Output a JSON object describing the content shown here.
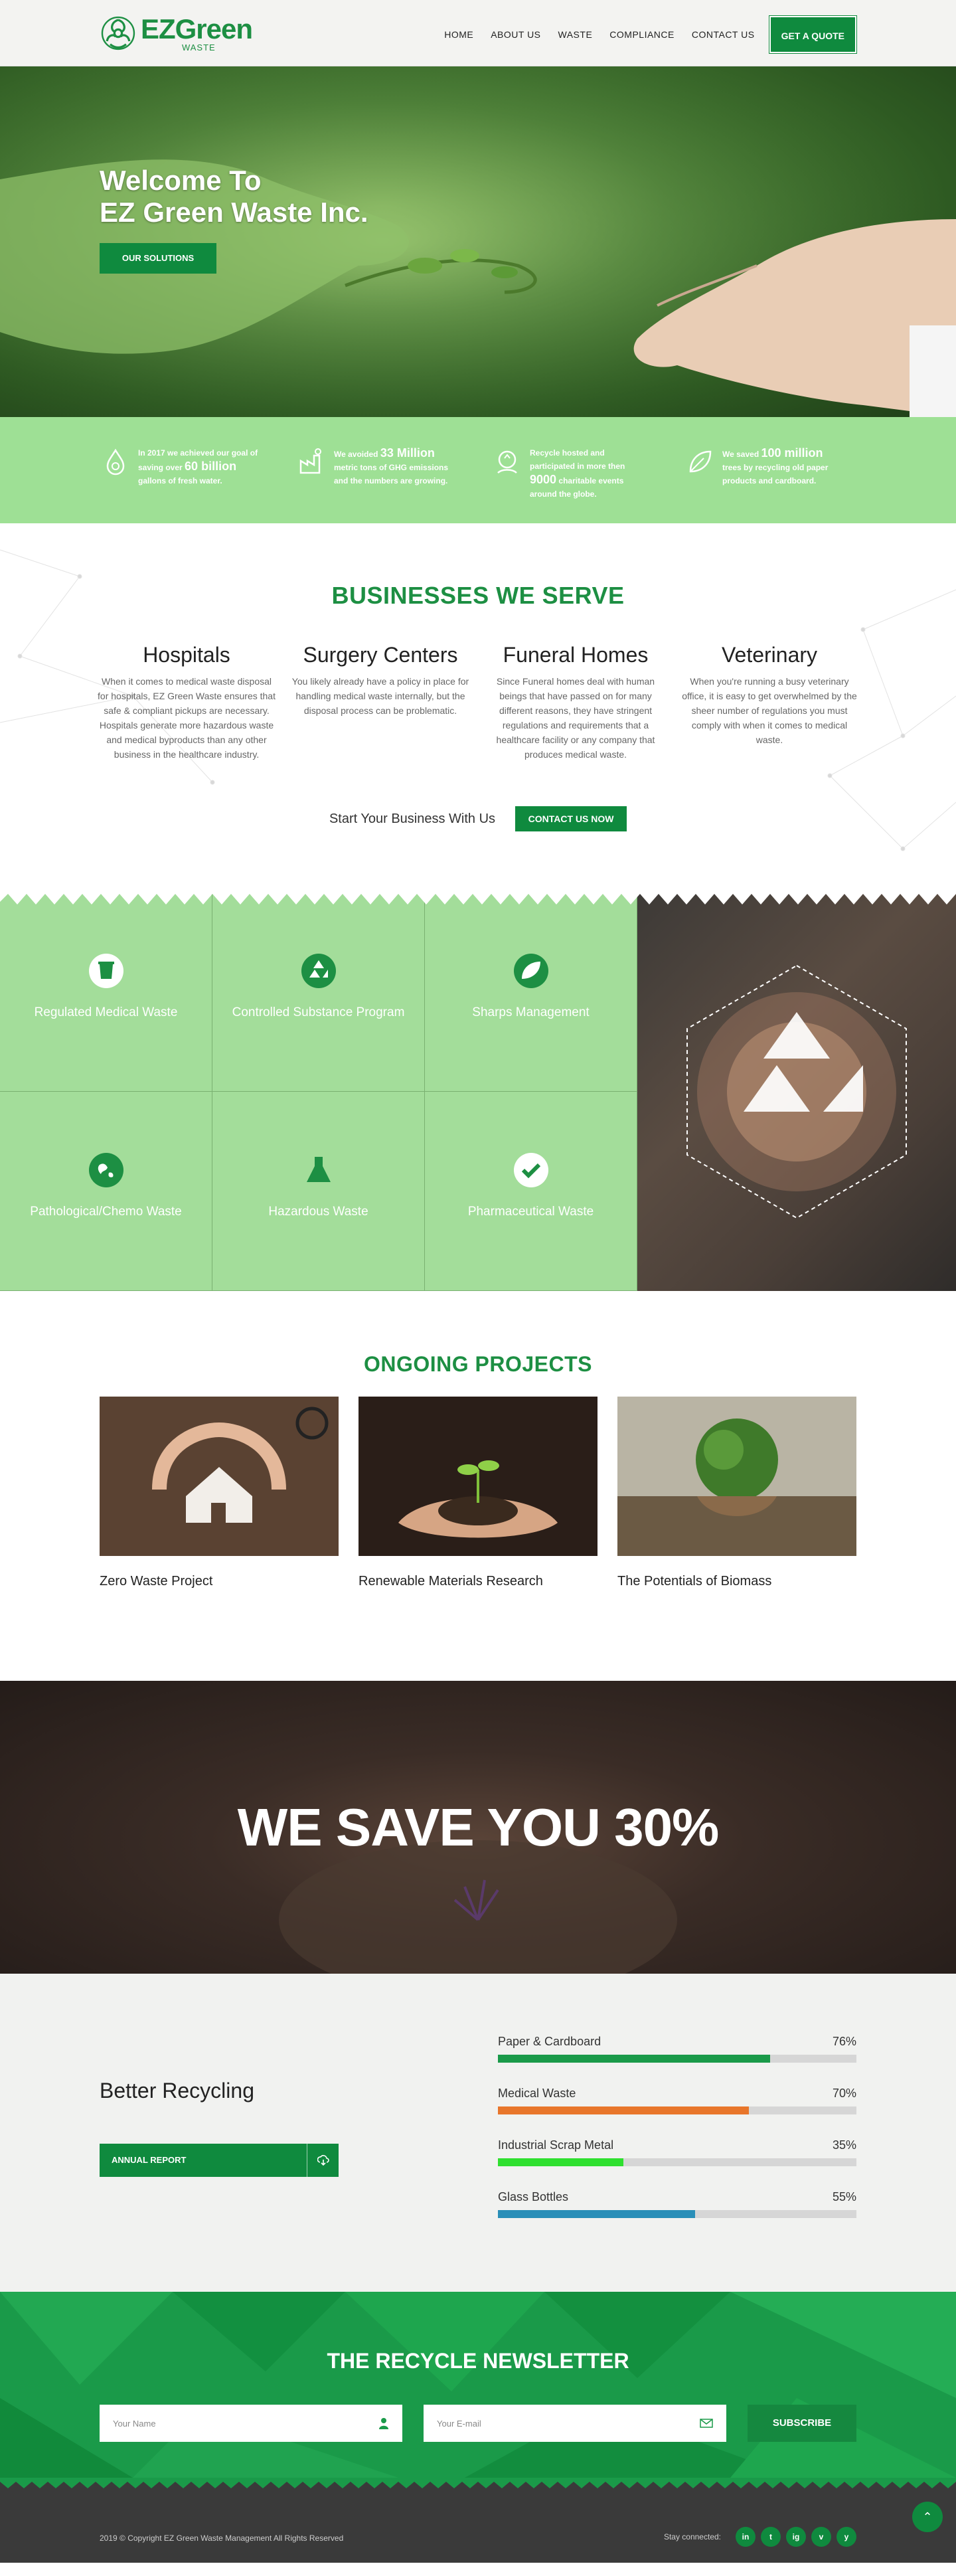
{
  "header": {
    "logo_name": "EZGreen",
    "logo_sub": "WASTE",
    "nav": [
      "HOME",
      "ABOUT US",
      "WASTE",
      "COMPLIANCE",
      "CONTACT US"
    ],
    "quote_label": "GET A QUOTE"
  },
  "hero": {
    "title_line1": "Welcome To",
    "title_line2": "EZ Green Waste Inc.",
    "button_label": "OUR SOLUTIONS"
  },
  "stats": [
    {
      "pre": "In 2017 we achieved our goal of saving over",
      "highlight": "60 billion",
      "post": "gallons of fresh water."
    },
    {
      "pre": "We avoided",
      "highlight": "33 Million",
      "post": "metric tons of GHG emissions and the numbers are growing."
    },
    {
      "pre": "Recycle hosted and participated in more then",
      "highlight": "9000",
      "post": "charitable events around the globe."
    },
    {
      "pre": "We saved",
      "highlight": "100 million",
      "post": "trees by recycling old paper products and cardboard."
    }
  ],
  "businesses": {
    "title": "BUSINESSES WE SERVE",
    "items": [
      {
        "title": "Hospitals",
        "text": "When it comes to medical waste disposal for hospitals, EZ Green Waste ensures that safe & compliant pickups are necessary. Hospitals generate more hazardous waste and medical byproducts than any other business in the healthcare industry."
      },
      {
        "title": "Surgery Centers",
        "text": "You likely already have a policy in place for handling medical waste internally, but the disposal process can be problematic."
      },
      {
        "title": "Funeral Homes",
        "text": "Since Funeral homes deal with human beings that have passed on for many different reasons, they have stringent regulations and requirements that a healthcare facility or any company that produces medical waste."
      },
      {
        "title": "Veterinary",
        "text": "When you're running a busy veterinary office, it is easy to get overwhelmed by the sheer number of regulations you must comply with when it comes to medical waste."
      }
    ],
    "cta_text": "Start Your Business With Us",
    "cta_button": "CONTACT US NOW"
  },
  "services": [
    {
      "label": "Regulated Medical Waste",
      "icon": "bin-icon"
    },
    {
      "label": "Controlled Substance Program",
      "icon": "recycle-icon"
    },
    {
      "label": "Sharps Management",
      "icon": "leaf-icon"
    },
    {
      "label": "Pathological/Chemo Waste",
      "icon": "globe-icon"
    },
    {
      "label": "Hazardous Waste",
      "icon": "flask-icon"
    },
    {
      "label": "Pharmaceutical Waste",
      "icon": "check-icon"
    }
  ],
  "projects": {
    "title": "ONGOING PROJECTS",
    "items": [
      {
        "title": "Zero Waste Project"
      },
      {
        "title": "Renewable Materials Research"
      },
      {
        "title": "The Potentials of Biomass"
      }
    ]
  },
  "save": {
    "text": "WE SAVE YOU 30%"
  },
  "recycling": {
    "title": "Better Recycling",
    "report_label": "ANNUAL REPORT",
    "bars": [
      {
        "label": "Paper & Cardboard",
        "pct_label": "76%",
        "value": 0.76,
        "color": "#1a9a49"
      },
      {
        "label": "Medical Waste",
        "pct_label": "70%",
        "value": 0.7,
        "color": "#e8762b"
      },
      {
        "label": "Industrial Scrap Metal",
        "pct_label": "35%",
        "value": 0.35,
        "color": "#2fe02f"
      },
      {
        "label": "Glass Bottles",
        "pct_label": "55%",
        "value": 0.55,
        "color": "#2a8fb8"
      }
    ]
  },
  "newsletter": {
    "title": "THE RECYCLE NEWSLETTER",
    "name_placeholder": "Your Name",
    "email_placeholder": "Your E-mail",
    "button": "SUBSCRIBE"
  },
  "footer": {
    "copyright": "2019 © Copyright EZ Green Waste Management All Rights Reserved",
    "social_label": "Stay connected:",
    "social": [
      "in",
      "t",
      "ig",
      "v",
      "y"
    ]
  }
}
